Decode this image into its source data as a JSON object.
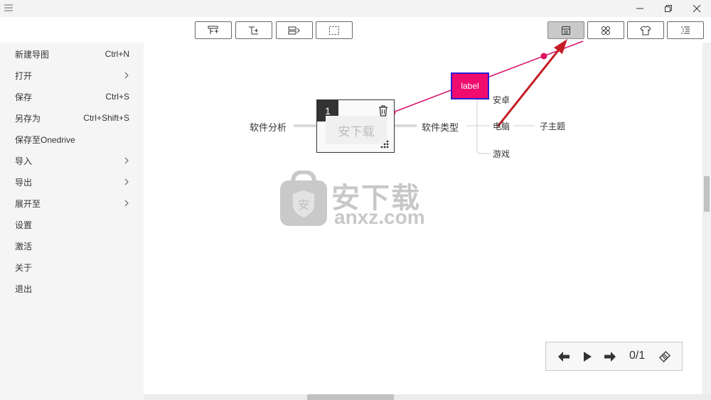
{
  "window": {
    "menu_icon": "hamburger-icon",
    "controls": [
      "minimize-icon",
      "restore-icon",
      "close-icon"
    ]
  },
  "toolbar": {
    "left_buttons": [
      "add-subtopic-icon",
      "insert-topic-icon",
      "add-label-icon",
      "select-region-icon"
    ],
    "right_buttons": [
      "presentation-icon",
      "layout-icon",
      "theme-shirt-icon",
      "outline-icon"
    ],
    "active": "presentation-icon"
  },
  "menu": {
    "items": [
      {
        "label": "新建导图",
        "shortcut": "Ctrl+N",
        "submenu": false
      },
      {
        "label": "打开",
        "shortcut": "",
        "submenu": true
      },
      {
        "label": "保存",
        "shortcut": "Ctrl+S",
        "submenu": false
      },
      {
        "label": "另存为",
        "shortcut": "Ctrl+Shift+S",
        "submenu": false
      },
      {
        "label": "保存至Onedrive",
        "shortcut": "",
        "submenu": false
      },
      {
        "label": "导入",
        "shortcut": "",
        "submenu": true
      },
      {
        "label": "导出",
        "shortcut": "",
        "submenu": true
      },
      {
        "label": "展开至",
        "shortcut": "",
        "submenu": true
      },
      {
        "label": "设置",
        "shortcut": "",
        "submenu": false
      },
      {
        "label": "激活",
        "shortcut": "",
        "submenu": false
      },
      {
        "label": "关于",
        "shortcut": "",
        "submenu": false
      },
      {
        "label": "退出",
        "shortcut": "",
        "submenu": false
      }
    ]
  },
  "mindmap": {
    "root": "软件分析",
    "node": {
      "number": "1",
      "title": "安下载"
    },
    "branch": "软件类型",
    "children": [
      "安卓",
      "电脑",
      "游戏"
    ],
    "grandchild": "子主题",
    "label": "label"
  },
  "watermark": {
    "main": "安下载",
    "domain": "anxz.com"
  },
  "playback": {
    "count": "0/1"
  },
  "colors": {
    "accent": "#ef0c6e",
    "label_border": "#2a1fd6",
    "arrow": "#d0202a"
  }
}
